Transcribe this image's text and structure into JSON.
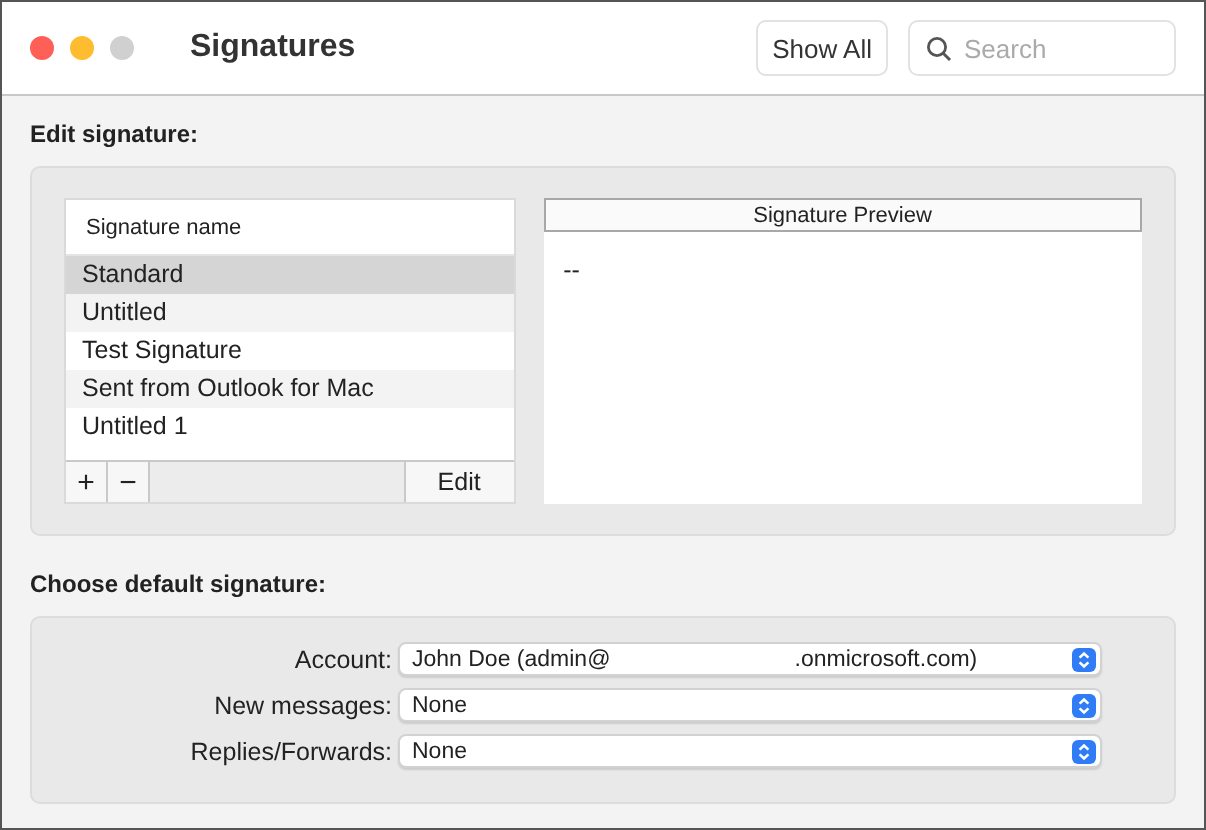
{
  "window": {
    "title": "Signatures"
  },
  "toolbar": {
    "show_all": "Show All",
    "search": {
      "placeholder": "Search"
    }
  },
  "edit_section": {
    "heading": "Edit signature:",
    "list": {
      "column": "Signature name",
      "items": [
        {
          "name": "Standard",
          "selected": true
        },
        {
          "name": "Untitled",
          "selected": false
        },
        {
          "name": "Test Signature",
          "selected": false
        },
        {
          "name": "Sent from Outlook for Mac",
          "selected": false
        },
        {
          "name": "Untitled 1",
          "selected": false
        }
      ],
      "buttons": [
        "+",
        "−"
      ],
      "edit": "Edit"
    },
    "preview": {
      "header": "Signature Preview",
      "text": "--"
    }
  },
  "default_section": {
    "heading": "Choose default signature:",
    "rows": [
      {
        "label": "Account:",
        "value": "John Doe (admin@",
        "value_end": ".onmicrosoft.com)"
      },
      {
        "label": "New messages:",
        "value": "None"
      },
      {
        "label": "Replies/Forwards:",
        "value": "None"
      }
    ]
  }
}
